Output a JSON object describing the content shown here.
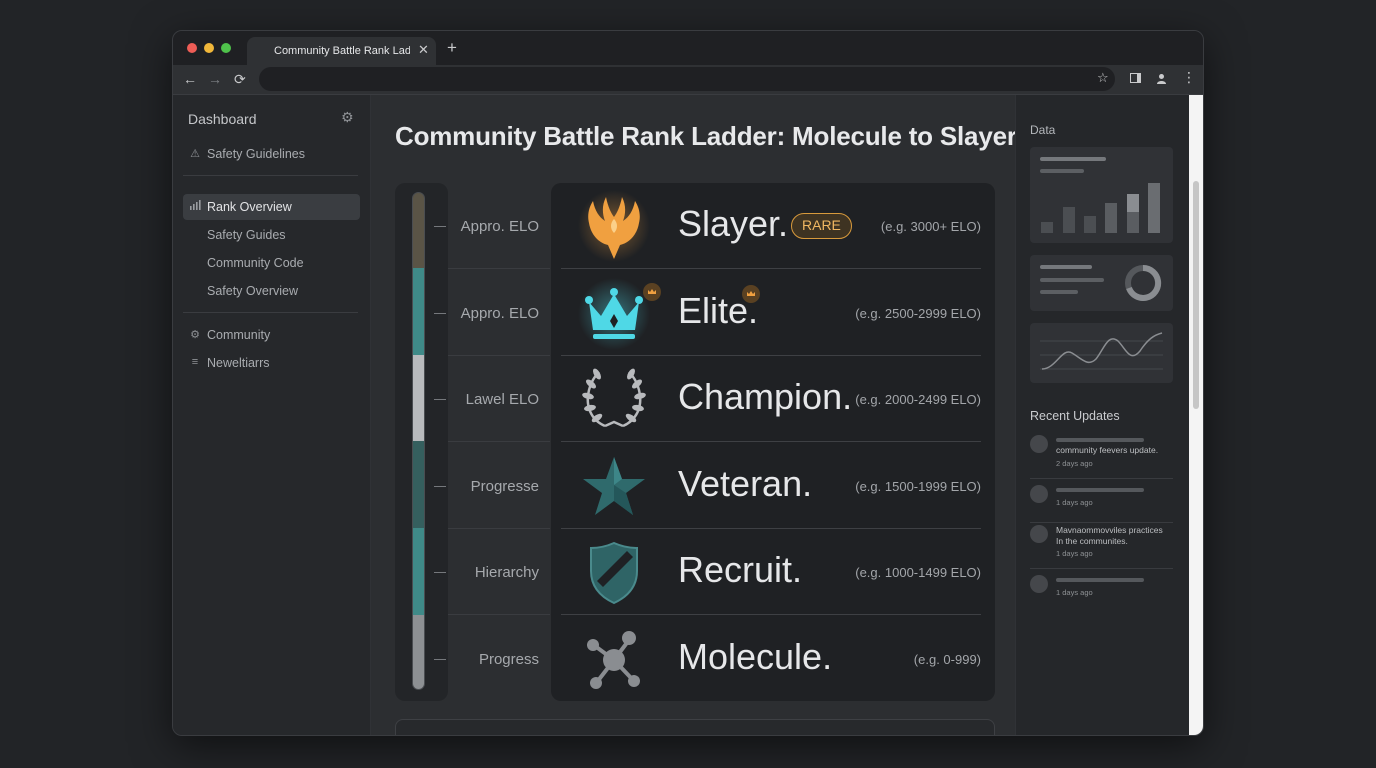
{
  "browser": {
    "tab_title": "Community Battle Rank Ladder: Molecule to Slayer",
    "tab_close": "✕",
    "new_tab": "+"
  },
  "sidebar": {
    "title": "Dashboard",
    "items": [
      {
        "label": "Safety Guidelines",
        "icon": "warning-icon"
      },
      {
        "label": "Rank Overview",
        "icon": "bar-chart-icon",
        "active": true
      },
      {
        "label": "Safety Guides"
      },
      {
        "label": "Community Code"
      },
      {
        "label": "Safety Overview"
      },
      {
        "label": "Community",
        "icon": "gear-icon"
      },
      {
        "label": "Neweltiarrs",
        "icon": "list-icon"
      }
    ]
  },
  "main": {
    "title": "Community Battle Rank Ladder: Molecule to Slayer",
    "levels": [
      "Appro. ELO",
      "Appro. ELO",
      "Lawel ELO",
      "Progresse",
      "Hierarchy",
      "Progress"
    ],
    "ranks": [
      {
        "name": "Slayer.",
        "elo": "(e.g. 3000+ ELO)",
        "badge": "RARE",
        "icon": "phoenix-icon",
        "color": "#f0a040"
      },
      {
        "name": "Elite.",
        "elo": "(e.g. 2500-2999 ELO)",
        "icon": "crown-icon",
        "color": "#4fd8e6"
      },
      {
        "name": "Champion.",
        "elo": "(e.g. 2000-2499 ELO)",
        "icon": "laurel-wreath-icon",
        "color": "#a9acb0"
      },
      {
        "name": "Veteran.",
        "elo": "(e.g. 1500-1999 ELO)",
        "icon": "star-icon",
        "color": "#2f6a6c"
      },
      {
        "name": "Recruit.",
        "elo": "(e.g. 1000-1499 ELO)",
        "icon": "shield-icon",
        "color": "#2f6466"
      },
      {
        "name": "Molecule.",
        "elo": "(e.g. 0-999)",
        "icon": "molecule-icon",
        "color": "#8a8d91"
      }
    ],
    "progress_segments": [
      "#5a5446",
      "#3f8a88",
      "#b8babd",
      "#355f5e",
      "#3f8a88",
      "#8d9093"
    ]
  },
  "right_sidebar": {
    "data_title": "Data",
    "updates_title": "Recent Updates",
    "updates": [
      {
        "text": [
          "community feevers update."
        ],
        "time": "2 days ago"
      },
      {
        "text": [],
        "time": "1 days ago"
      },
      {
        "text": [
          "Mavnaommovviles practices",
          "In the communites."
        ],
        "time": "1 days ago"
      },
      {
        "text": [],
        "time": "1 days ago"
      }
    ]
  }
}
